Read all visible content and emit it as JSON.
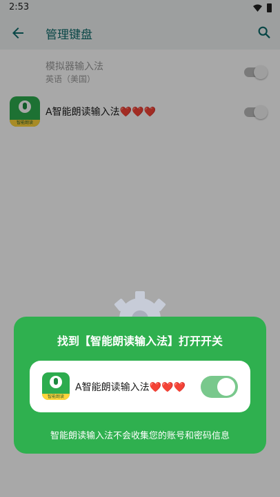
{
  "status_bar": {
    "time": "2:53"
  },
  "app_bar": {
    "title": "管理键盘"
  },
  "keyboards": [
    {
      "name": "模拟器输入法",
      "subtitle": "英语（美国）",
      "enabled": false,
      "disabled_row": true
    },
    {
      "name": "A智能朗读输入法❤️❤️❤️",
      "enabled": false,
      "icon_caption": "智能朗读"
    }
  ],
  "guide": {
    "title": "找到【智能朗读输入法】打开开关",
    "app_label": "A智能朗读输入法❤️❤️❤️",
    "app_icon_caption": "智能朗读",
    "switch_on": true,
    "note": "智能朗读输入法不会收集您的账号和密码信息"
  },
  "colors": {
    "accent": "#0d6b6b",
    "card_green": "#2fb04f",
    "switch_on": "#79c88c",
    "icon_yellow": "#ffd43b"
  }
}
